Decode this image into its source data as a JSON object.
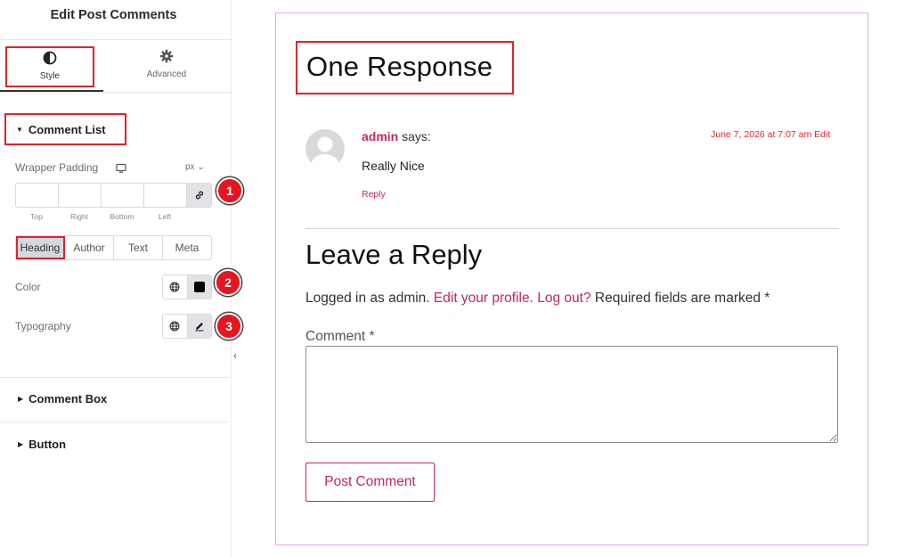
{
  "panel": {
    "title": "Edit Post Comments",
    "tabs": [
      {
        "label": "Style",
        "icon": "half-circle-contrast-icon",
        "active": true
      },
      {
        "label": "Advanced",
        "icon": "gear-icon",
        "active": false
      }
    ],
    "sections": {
      "comment_list": {
        "label": "Comment List",
        "expanded": true
      },
      "comment_box": {
        "label": "Comment Box",
        "expanded": false
      },
      "button": {
        "label": "Button",
        "expanded": false
      }
    },
    "wrapper_padding": {
      "label": "Wrapper Padding",
      "unit": "px",
      "fields": [
        "Top",
        "Right",
        "Bottom",
        "Left"
      ]
    },
    "subtabs": [
      "Heading",
      "Author",
      "Text",
      "Meta"
    ],
    "active_subtab": "Heading",
    "color_label": "Color",
    "typography_label": "Typography",
    "badges": [
      "1",
      "2",
      "3"
    ]
  },
  "preview": {
    "responses_title": "One Response",
    "comment": {
      "author": "admin",
      "says": "says:",
      "date": "June 7, 2026 at 7:07 am",
      "edit": "Edit",
      "text": "Really Nice",
      "reply": "Reply"
    },
    "reply_form": {
      "title": "Leave a Reply",
      "logged_in_prefix": "Logged in as admin.",
      "edit_profile": "Edit your profile.",
      "log_out": "Log out?",
      "required_note": "Required fields are marked *",
      "comment_label": "Comment *",
      "submit_label": "Post Comment"
    }
  },
  "colors": {
    "accent": "#c0295a",
    "highlight_border": "#d9262e",
    "badge": "#e8141f",
    "preview_border": "#e3a8e6"
  }
}
